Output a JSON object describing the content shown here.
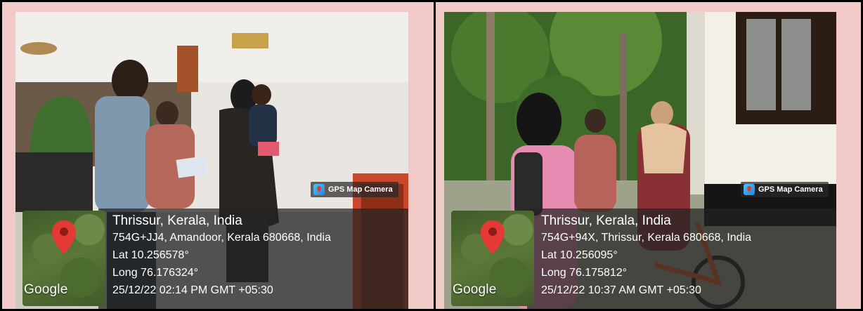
{
  "badge_text": "GPS Map Camera",
  "map_brand": "Google",
  "photos": [
    {
      "location": "Thrissur, Kerala, India",
      "address": "754G+JJ4, Amandoor, Kerala 680668, India",
      "lat": "Lat 10.256578°",
      "long": "Long 76.176324°",
      "datetime": "25/12/22 02:14 PM GMT +05:30"
    },
    {
      "location": "Thrissur, Kerala, India",
      "address": "754G+94X, Thrissur, Kerala 680668, India",
      "lat": "Lat 10.256095°",
      "long": "Long 76.175812°",
      "datetime": "25/12/22 10:37 AM GMT +05:30"
    }
  ],
  "colors": {
    "cell_bg": "#f1c9c6",
    "border": "#000000",
    "pin": "#e53935"
  }
}
